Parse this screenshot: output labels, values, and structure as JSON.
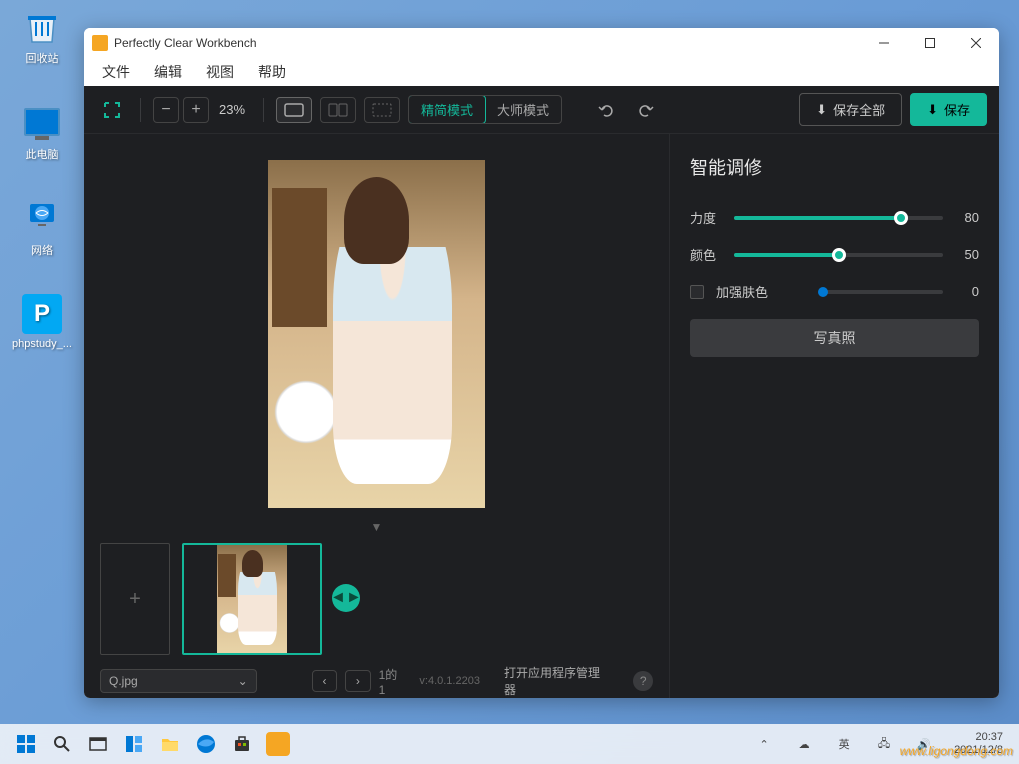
{
  "desktop": {
    "recycle": "回收站",
    "thispc": "此电脑",
    "network": "网络",
    "phpstudy": "phpstudy_..."
  },
  "app": {
    "title": "Perfectly Clear Workbench",
    "menu": {
      "file": "文件",
      "edit": "编辑",
      "view": "视图",
      "help": "帮助"
    },
    "toolbar": {
      "zoom": "23%",
      "mode_simple": "精简模式",
      "mode_master": "大师模式",
      "save_all": "保存全部",
      "save": "保存"
    },
    "bottom": {
      "filename": "Q.jpg",
      "page_info": "1的1",
      "version": "v:4.0.1.2203",
      "manager": "打开应用程序管理器"
    },
    "panel": {
      "title": "智能调修",
      "strength_label": "力度",
      "strength_value": "80",
      "color_label": "颜色",
      "color_value": "50",
      "skin_label": "加强肤色",
      "skin_value": "0",
      "portrait_btn": "写真照"
    }
  },
  "taskbar": {
    "time": "20:37",
    "date": "2021/12/8",
    "watermark": "www.ligongdong.com"
  }
}
